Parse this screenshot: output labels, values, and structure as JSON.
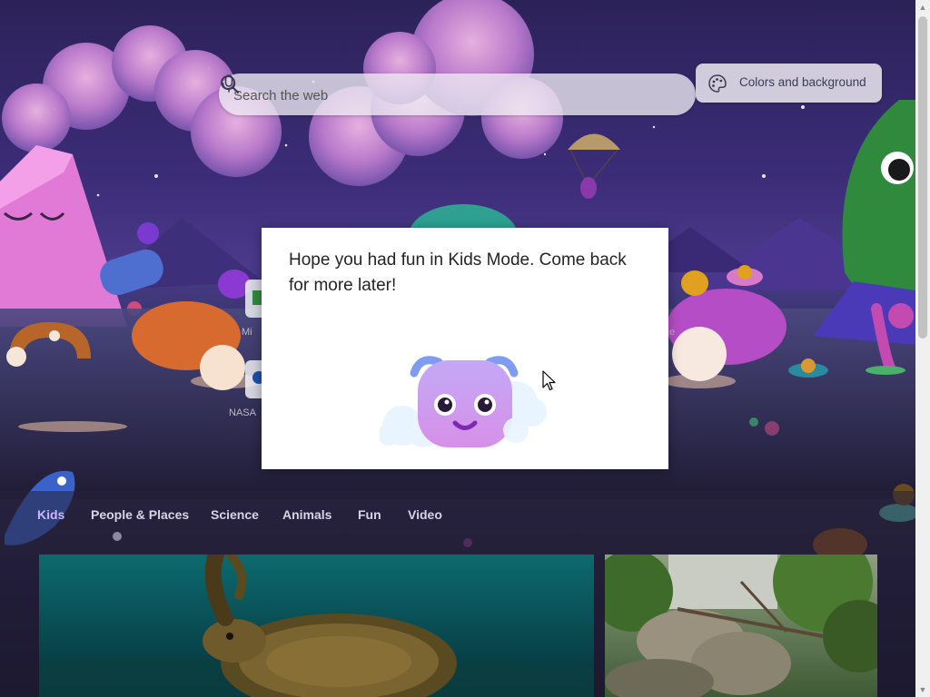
{
  "search": {
    "placeholder": "Search the web"
  },
  "header": {
    "colors_button_label": "Colors and background"
  },
  "tabs": [
    {
      "label": "Kids",
      "active": true
    },
    {
      "label": "People & Places"
    },
    {
      "label": "Science"
    },
    {
      "label": "Animals"
    },
    {
      "label": "Fun"
    },
    {
      "label": "Video"
    }
  ],
  "quick_links": {
    "partial_labels": [
      "Mi",
      "NASA",
      "e"
    ]
  },
  "modal": {
    "message": "Hope you had fun in Kids Mode. Come back for more later!"
  },
  "icons": {
    "mic": "microphone-icon",
    "search": "search-icon",
    "palette": "palette-icon",
    "mascot": "kids-mode-mascot"
  },
  "colors": {
    "accent": "#c9b6ff",
    "modal_bg": "#ffffff",
    "scene_sky": "#2c2259"
  }
}
